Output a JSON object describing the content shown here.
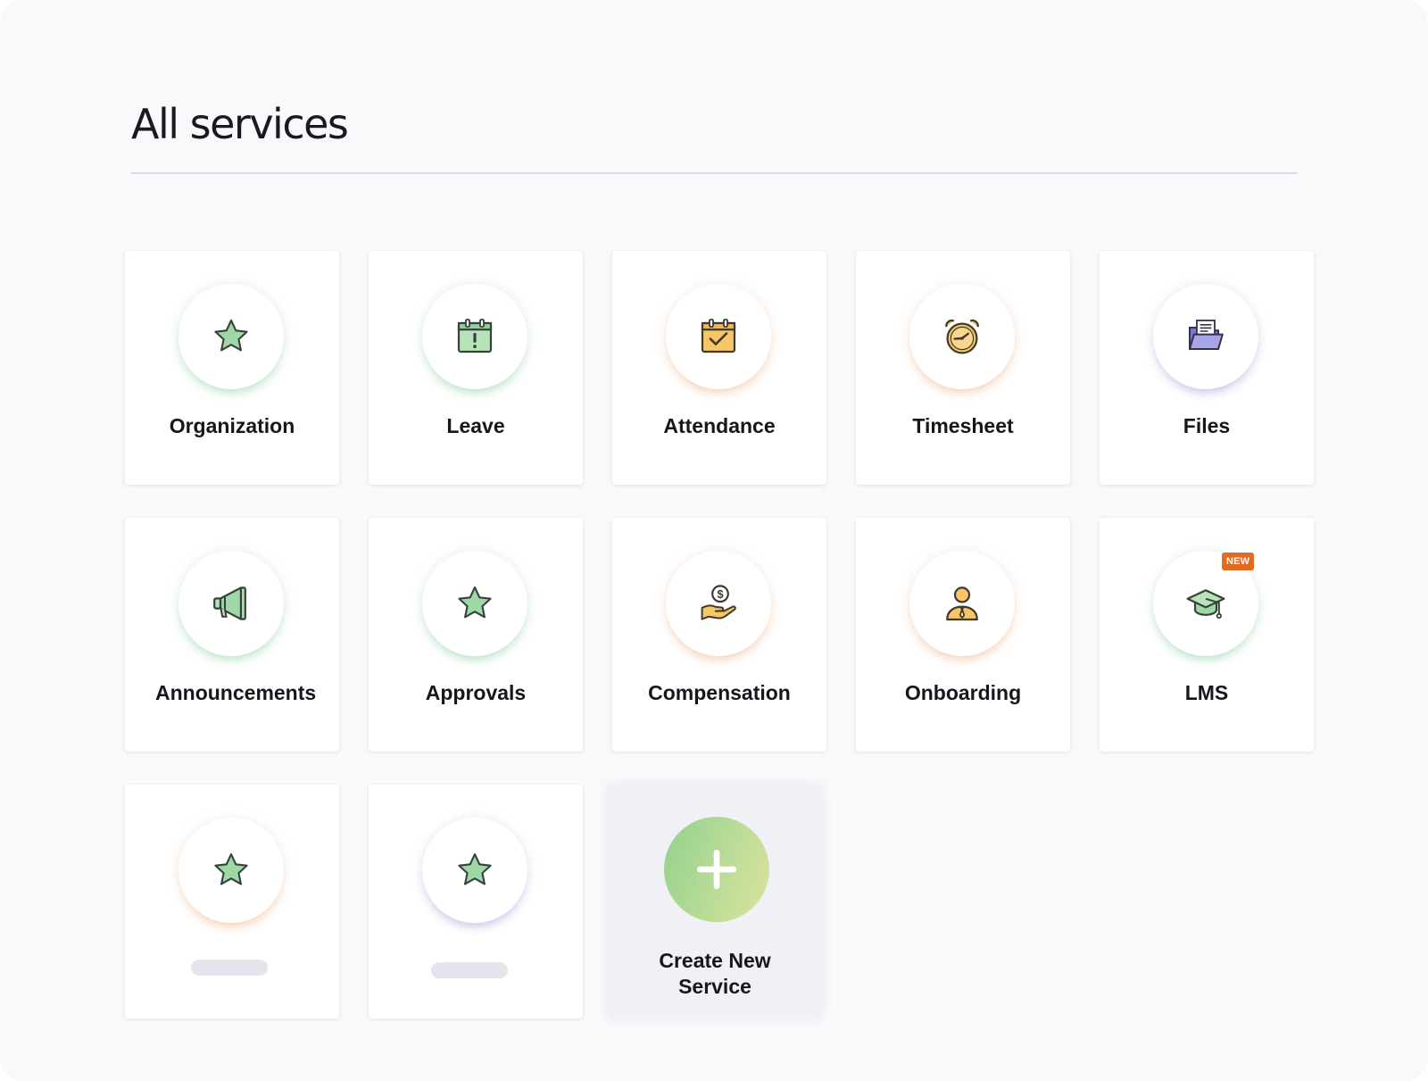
{
  "page": {
    "title": "All services"
  },
  "services": [
    {
      "label": "Organization"
    },
    {
      "label": "Leave"
    },
    {
      "label": "Attendance"
    },
    {
      "label": "Timesheet"
    },
    {
      "label": "Files"
    },
    {
      "label": "Announcements"
    },
    {
      "label": "Approvals"
    },
    {
      "label": "Compensation"
    },
    {
      "label": "Onboarding"
    },
    {
      "label": "LMS",
      "badge": "NEW"
    }
  ],
  "create": {
    "line1": "Create New",
    "line2": "Service"
  },
  "colors": {
    "background": "#f8f9fb",
    "card": "#ffffff",
    "icon_green": "#9ed8a6",
    "icon_orange": "#f6c667",
    "icon_purple": "#a9a4e6",
    "badge": "#e36a1f",
    "create_gradient_start": "#92d18e",
    "create_gradient_end": "#dbe39e"
  },
  "icons": [
    "star-icon",
    "calendar-alert-icon",
    "calendar-check-icon",
    "alarm-clock-icon",
    "folder-files-icon",
    "megaphone-icon",
    "star-icon",
    "hand-coin-icon",
    "person-tie-icon",
    "graduation-cap-icon",
    "star-icon",
    "star-icon",
    "plus-icon"
  ]
}
